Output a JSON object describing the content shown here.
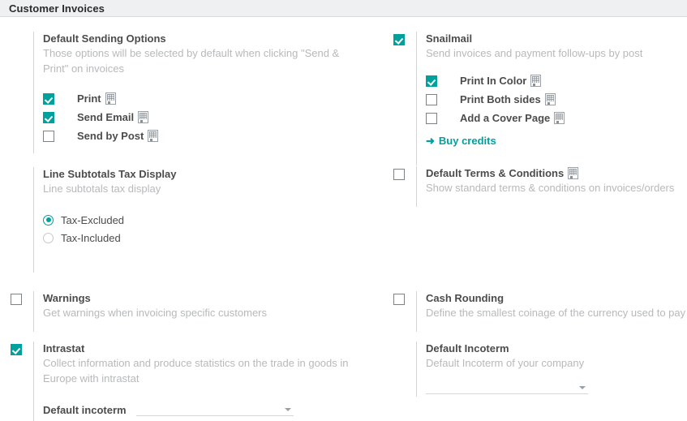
{
  "header": {
    "title": "Customer Invoices"
  },
  "colors": {
    "accent_teal": "#00a09d",
    "header_bg": "#eef0f2",
    "title_text": "#4c4c4c",
    "muted_text": "#b7b9bb"
  },
  "left_column": [
    {
      "name": "default-sending-options",
      "has_main_checkbox": false,
      "title": "Default Sending Options",
      "description": "Those options will be selected by default when clicking \"Send & Print\" on invoices",
      "sub_options": [
        {
          "label": "Print",
          "checked": true,
          "icon": "building-icon"
        },
        {
          "label": "Send Email",
          "checked": true,
          "icon": "building-icon"
        },
        {
          "label": "Send by Post",
          "checked": false,
          "icon": "building-icon"
        }
      ]
    },
    {
      "name": "line-subtotals-tax-display",
      "has_main_checkbox": false,
      "title": "Line Subtotals Tax Display",
      "description": "Line subtotals tax display",
      "radios": [
        {
          "label": "Tax-Excluded",
          "selected": true
        },
        {
          "label": "Tax-Included",
          "selected": false
        }
      ]
    },
    {
      "name": "warnings",
      "has_main_checkbox": true,
      "checked": false,
      "title": "Warnings",
      "description": "Get warnings when invoicing specific customers"
    },
    {
      "name": "intrastat",
      "has_main_checkbox": true,
      "checked": true,
      "title": "Intrastat",
      "description": "Collect information and produce statistics on the trade in goods in Europe with intrastat",
      "dropdown": {
        "label": "Default incoterm",
        "value": "",
        "caret": "chevron-down-icon"
      }
    }
  ],
  "right_column": [
    {
      "name": "snailmail",
      "has_main_checkbox": true,
      "checked": true,
      "title": "Snailmail",
      "description": "Send invoices and payment follow-ups by post",
      "sub_options": [
        {
          "label": "Print In Color",
          "checked": true,
          "icon": "building-icon"
        },
        {
          "label": "Print Both sides",
          "checked": false,
          "icon": "building-icon"
        },
        {
          "label": "Add a Cover Page",
          "checked": false,
          "icon": "building-icon"
        }
      ],
      "link": {
        "label": "Buy credits",
        "icon": "arrow-right-icon"
      }
    },
    {
      "name": "default-terms-conditions",
      "has_main_checkbox": true,
      "checked": false,
      "title": "Default Terms & Conditions",
      "title_icon": "building-icon",
      "description": "Show standard terms & conditions on invoices/orders"
    },
    {
      "name": "cash-rounding",
      "has_main_checkbox": true,
      "checked": false,
      "title": "Cash Rounding",
      "description": "Define the smallest coinage of the currency used to pay"
    },
    {
      "name": "default-incoterm",
      "has_main_checkbox": false,
      "title": "Default Incoterm",
      "description": "Default Incoterm of your company",
      "dropdown": {
        "label": "",
        "value": "",
        "caret": "chevron-down-icon"
      }
    }
  ]
}
